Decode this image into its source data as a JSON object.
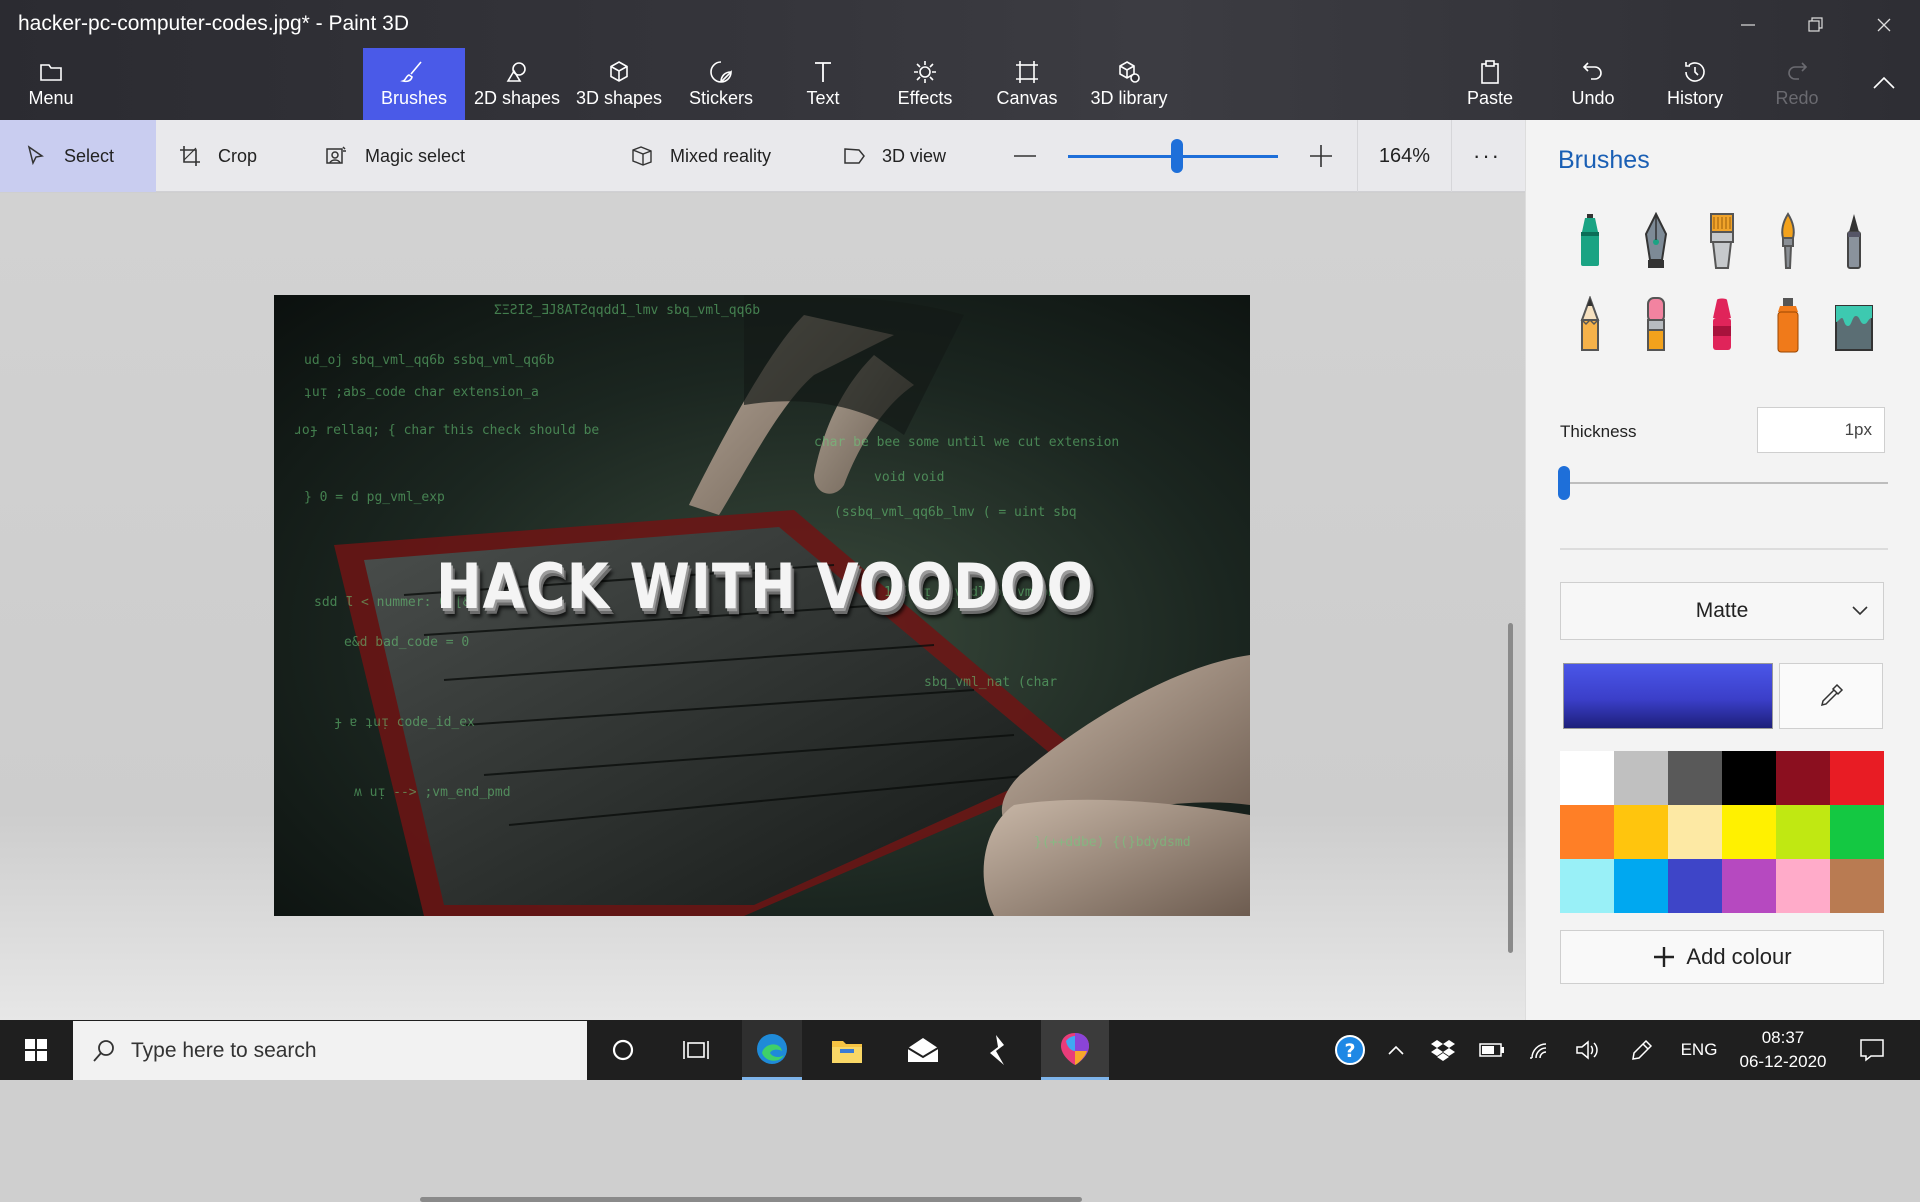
{
  "window": {
    "title": "hacker-pc-computer-codes.jpg* - Paint 3D"
  },
  "ribbon": {
    "menu": "Menu",
    "tabs": [
      "Brushes",
      "2D shapes",
      "3D shapes",
      "Stickers",
      "Text",
      "Effects",
      "Canvas",
      "3D library"
    ],
    "active_tab": "Brushes",
    "actions": [
      "Paste",
      "Undo",
      "History",
      "Redo"
    ]
  },
  "toolbar": {
    "select": "Select",
    "crop": "Crop",
    "magic_select": "Magic select",
    "mixed_reality": "Mixed reality",
    "view_3d": "3D view",
    "zoom": "164%",
    "zoom_level": 0.52,
    "more": "···"
  },
  "canvas": {
    "headline": "HACK WITH VOODOO"
  },
  "panel": {
    "title": "Brushes",
    "thickness_label": "Thickness",
    "thickness_value": "1px",
    "thickness_level": 0.0,
    "finish": "Matte",
    "current_color": "#3b3fc9",
    "add_colour": "Add colour",
    "palette": [
      "#ffffff",
      "#c0c0c0",
      "#595959",
      "#000000",
      "#8b0f1f",
      "#e81c24",
      "#ff7f26",
      "#ffc50d",
      "#fde9a4",
      "#fff100",
      "#c0e812",
      "#14c842",
      "#99f0f7",
      "#00a8f0",
      "#3e45c8",
      "#b649c0",
      "#ffabc9",
      "#b97b52"
    ],
    "brushes": [
      "marker-icon",
      "calligraphy-pen-icon",
      "oil-brush-icon",
      "watercolor-icon",
      "pixel-pen-icon",
      "pencil-icon",
      "eraser-icon",
      "crayon-icon",
      "spray-can-icon",
      "fill-bucket-icon"
    ]
  },
  "taskbar": {
    "search_placeholder": "Type here to search",
    "lang": "ENG",
    "time": "08:37",
    "date": "06-12-2020"
  }
}
